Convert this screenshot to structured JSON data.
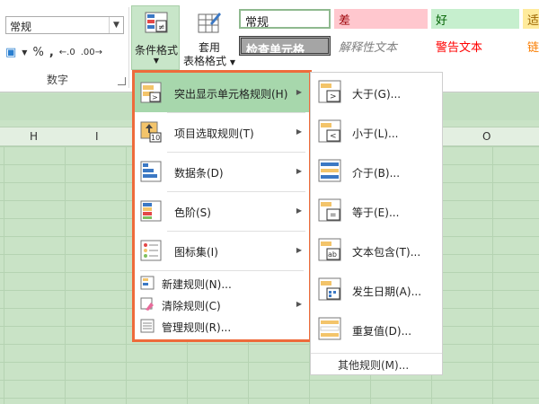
{
  "ribbon": {
    "number_format_value": "常规",
    "number_icons": [
      "$",
      "▾",
      "%",
      "›",
      " ",
      "←.0",
      ".00→"
    ],
    "number_group_label": "数字",
    "cond_format_label": "条件格式",
    "table_format_label_line1": "套用",
    "table_format_label_line2": "表格格式",
    "styles": [
      {
        "label": "常规"
      },
      {
        "label": "差"
      },
      {
        "label": "好"
      },
      {
        "label": "适"
      },
      {
        "label": "检查单元格"
      },
      {
        "label": "解释性文本"
      },
      {
        "label": "警告文本"
      },
      {
        "label": "链"
      }
    ]
  },
  "sheet": {
    "columns": [
      "H",
      "I",
      "O"
    ]
  },
  "menu": {
    "items": [
      {
        "label": "突出显示单元格规则(H)"
      },
      {
        "label": "项目选取规则(T)"
      },
      {
        "label": "数据条(D)"
      },
      {
        "label": "色阶(S)"
      },
      {
        "label": "图标集(I)"
      },
      {
        "label": "新建规则(N)..."
      },
      {
        "label": "清除规则(C)"
      },
      {
        "label": "管理规则(R)..."
      }
    ]
  },
  "submenu": {
    "items": [
      {
        "label": "大于(G)..."
      },
      {
        "label": "小于(L)..."
      },
      {
        "label": "介于(B)..."
      },
      {
        "label": "等于(E)..."
      },
      {
        "label": "文本包含(T)..."
      },
      {
        "label": "发生日期(A)..."
      },
      {
        "label": "重复值(D)..."
      }
    ],
    "other": "其他规则(M)..."
  },
  "colors": {
    "accent_border": "#ee6b3b",
    "highlight": "#a7d7ac",
    "sheet_bg": "#c9e3c6"
  }
}
